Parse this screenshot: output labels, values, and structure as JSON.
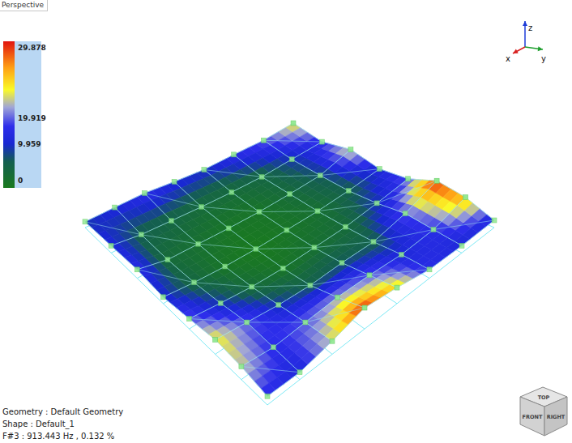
{
  "view_tab": {
    "label": "Perspective",
    "selected": true
  },
  "legend": {
    "ticks": [
      "29.878",
      "19.919",
      "9.959",
      "0"
    ]
  },
  "surface": {
    "values": [
      [
        8,
        10,
        12,
        9,
        14,
        20,
        18,
        12
      ],
      [
        10,
        5,
        3,
        4,
        8,
        14,
        12,
        10
      ],
      [
        12,
        4,
        2,
        1,
        3,
        8,
        14,
        18
      ],
      [
        10,
        3,
        1,
        0,
        1,
        5,
        16,
        29
      ],
      [
        9,
        3,
        1,
        1,
        2,
        6,
        14,
        22
      ],
      [
        12,
        4,
        3,
        2,
        3,
        5,
        10,
        12
      ],
      [
        14,
        8,
        6,
        5,
        8,
        14,
        12,
        10
      ],
      [
        20,
        12,
        19,
        10,
        14,
        29,
        24,
        10
      ]
    ]
  },
  "triad": {
    "axes": [
      {
        "label": "z",
        "color": "#1e3cd8"
      },
      {
        "label": "x",
        "color": "#d82020"
      },
      {
        "label": "y",
        "color": "#1e9e2e"
      }
    ]
  },
  "view_cube": {
    "faces": [
      "TOP",
      "FRONT",
      "RIGHT"
    ]
  },
  "info": [
    "Geometry : Default Geometry",
    "Shape : Default_1",
    "F#3 : 913.443 Hz , 0.132 %"
  ]
}
